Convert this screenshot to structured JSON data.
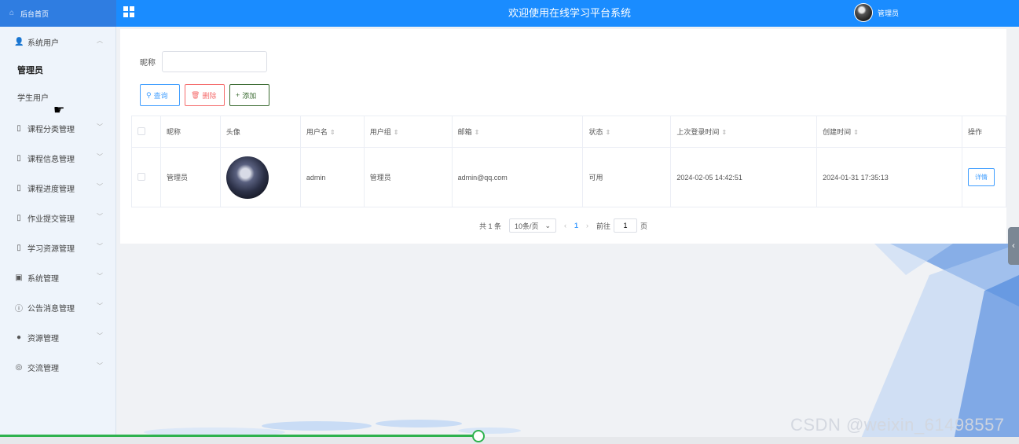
{
  "header": {
    "logo_text": "后台首页",
    "title": "欢迎使用在线学习平台系统",
    "user_name": "管理员"
  },
  "sidebar": {
    "groups": [
      {
        "label": "系统用户",
        "icon": "user-icon",
        "expanded": true
      },
      {
        "label": "课程分类管理",
        "icon": "doc-icon"
      },
      {
        "label": "课程信息管理",
        "icon": "doc-icon"
      },
      {
        "label": "课程进度管理",
        "icon": "doc-icon"
      },
      {
        "label": "作业提交管理",
        "icon": "doc-icon"
      },
      {
        "label": "学习资源管理",
        "icon": "doc-icon"
      },
      {
        "label": "系统管理",
        "icon": "image-icon"
      },
      {
        "label": "公告消息管理",
        "icon": "info-icon"
      },
      {
        "label": "资源管理",
        "icon": "pin-icon"
      },
      {
        "label": "交流管理",
        "icon": "chat-icon"
      }
    ],
    "sub_items": [
      {
        "label": "管理员",
        "active": true
      },
      {
        "label": "学生用户"
      }
    ]
  },
  "search": {
    "label": "昵称",
    "value": ""
  },
  "buttons": {
    "query": "查询",
    "delete": "删除",
    "add": "添加"
  },
  "table": {
    "headers": {
      "nickname": "昵称",
      "avatar": "头像",
      "username": "用户名",
      "group": "用户组",
      "email": "邮箱",
      "status": "状态",
      "last_login": "上次登录时间",
      "created": "创建时间",
      "actions": "操作"
    },
    "rows": [
      {
        "nickname": "管理员",
        "username": "admin",
        "group": "管理员",
        "email": "admin@qq.com",
        "status": "可用",
        "last_login": "2024-02-05 14:42:51",
        "created": "2024-01-31 17:35:13",
        "action": "详情"
      }
    ]
  },
  "pager": {
    "total": "共 1 条",
    "page_size": "10条/页",
    "current": "1",
    "goto_label": "前往",
    "goto_value": "1",
    "page_unit": "页"
  },
  "watermark": "CSDN @weixin_61498557",
  "colors": {
    "header": "#1a8cff",
    "primary": "#409eff",
    "danger": "#f56c6c",
    "progress": "#2eb24e"
  }
}
